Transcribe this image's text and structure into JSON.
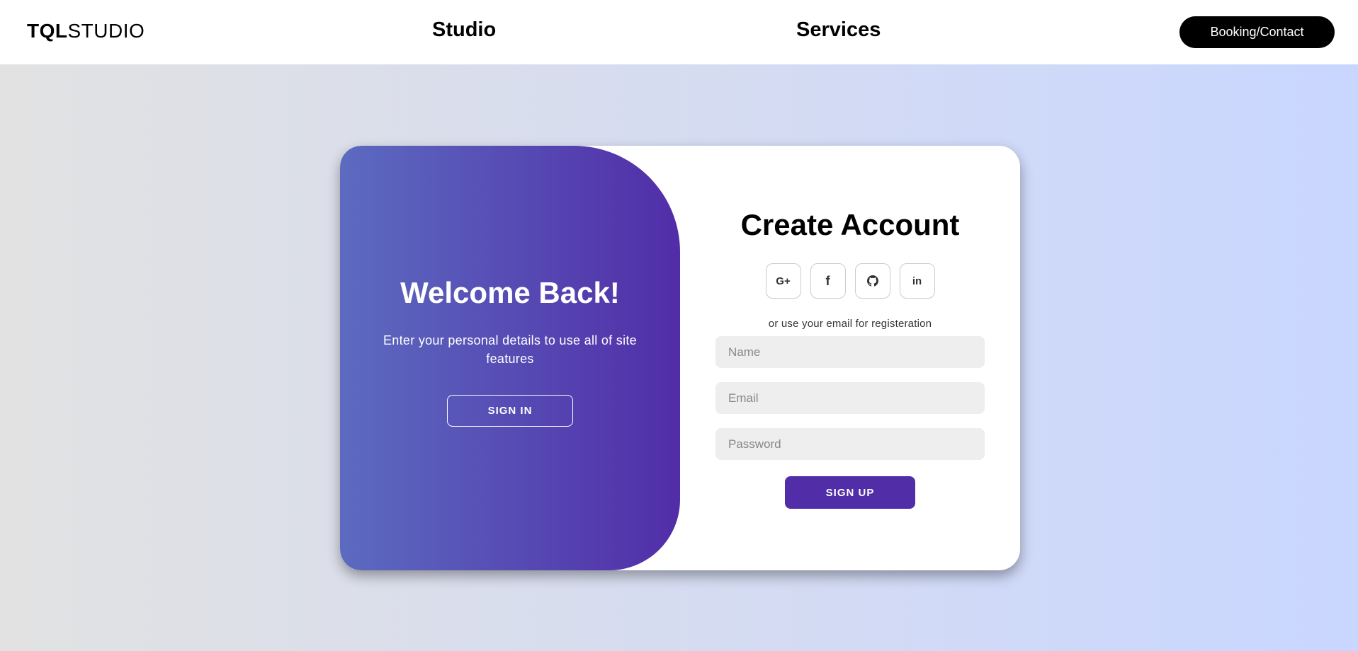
{
  "nav": {
    "brand_bold": "TQL",
    "brand_light": "STUDIO",
    "studio": "Studio",
    "services": "Services",
    "booking": "Booking/Contact"
  },
  "toggle_panel": {
    "title": "Welcome Back!",
    "text": "Enter your personal details to use all of site features",
    "sign_in": "SIGN IN",
    "gradient_start": "#5c6bc0",
    "gradient_end": "#512da8"
  },
  "form": {
    "title": "Create Account",
    "social": [
      {
        "icon": "google-plus-icon",
        "glyph": "G+"
      },
      {
        "icon": "facebook-icon",
        "glyph": "f"
      },
      {
        "icon": "github-icon",
        "glyph": ""
      },
      {
        "icon": "linkedin-icon",
        "glyph": "in"
      }
    ],
    "helper": "or use your email for registeration",
    "name_placeholder": "Name",
    "email_placeholder": "Email",
    "password_placeholder": "Password",
    "sign_up": "SIGN UP",
    "accent": "#512da8"
  }
}
